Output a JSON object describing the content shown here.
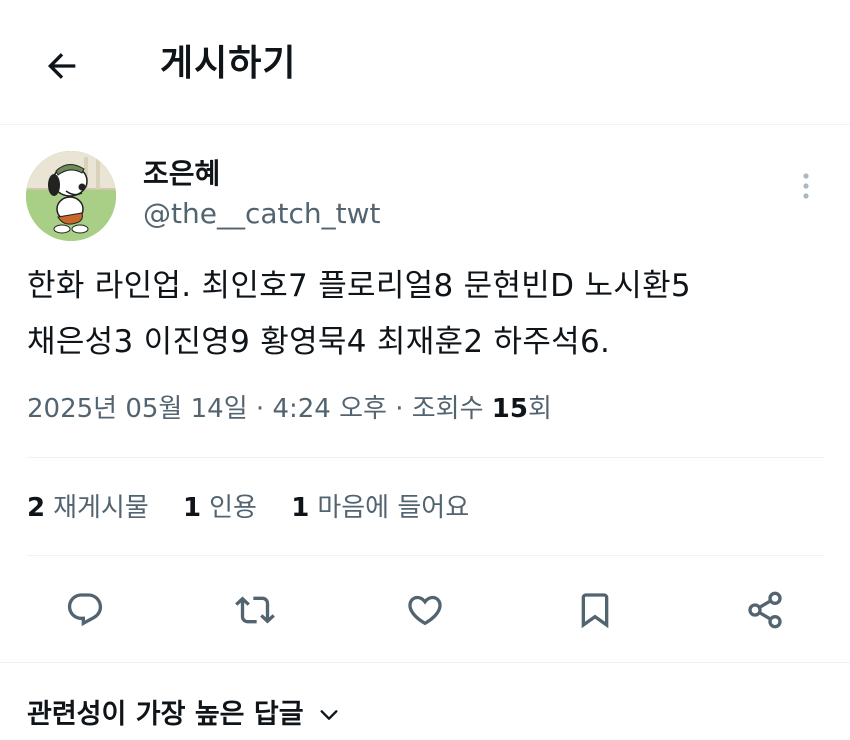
{
  "header": {
    "title": "게시하기",
    "back_icon": "arrow-left-icon"
  },
  "author": {
    "name": "조은혜",
    "handle": "@the__catch_twt",
    "avatar_icon": "snoopy-avatar"
  },
  "post": {
    "text": "한화 라인업. 최인호7 플로리얼8 문현빈D 노시환5\n채은성3 이진영9 황영묵4 최재훈2 하주석6."
  },
  "meta": {
    "date": "2025년 05월 14일",
    "time": "4:24 오후",
    "separator": "·",
    "views_label": "조회수",
    "views_count": "15",
    "views_suffix": "회"
  },
  "stats": {
    "reposts_count": "2",
    "reposts_label": "재게시물",
    "quotes_count": "1",
    "quotes_label": "인용",
    "likes_count": "1",
    "likes_label": "마음에 들어요"
  },
  "actions": [
    "reply-icon",
    "repost-icon",
    "like-icon",
    "bookmark-icon",
    "share-icon"
  ],
  "replies": {
    "sort_label": "관련성이 가장 높은 답글"
  },
  "colors": {
    "text": "#0f1419",
    "secondary": "#536471",
    "divider": "#eff3f4"
  }
}
